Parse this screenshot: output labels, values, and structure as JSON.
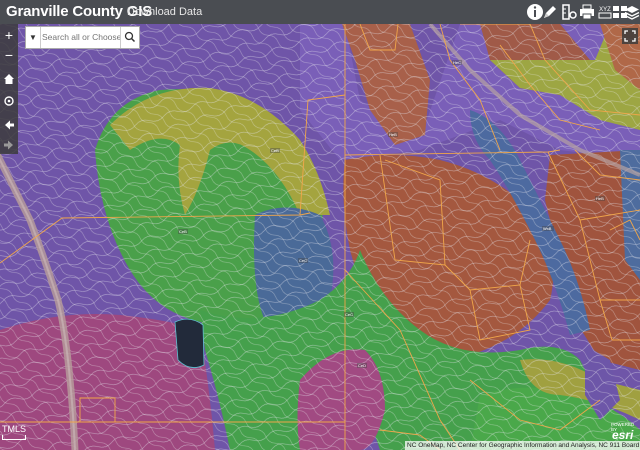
{
  "header": {
    "title": "Granville County GIS",
    "download_label": "Download Data",
    "icons": [
      "info-icon",
      "edit-pencil-icon",
      "measure-icon",
      "print-icon",
      "layer-list-icon",
      "basemap-gallery-icon",
      "layers-icon"
    ]
  },
  "search": {
    "placeholder": "Search all or Choose left",
    "value": ""
  },
  "map_controls": {
    "zoom_in": "+",
    "zoom_out": "−"
  },
  "scale": {
    "label": "TMLS"
  },
  "attribution": {
    "text": "NC OneMap, NC Center for Geographic Information and Analysis, NC 911 Board",
    "powered_by": "POWERED BY",
    "logo": "esri"
  },
  "colors": {
    "header_bg": "#4a4d52",
    "parcel_line": "#f0a64a",
    "soil_purple": "#7a5fb0",
    "soil_green": "#4da84a",
    "soil_olive": "#a7a544",
    "soil_brown": "#b56a4c",
    "soil_blue": "#486c9c",
    "soil_magenta": "#a34b82",
    "contour": "#e6e6f0"
  }
}
